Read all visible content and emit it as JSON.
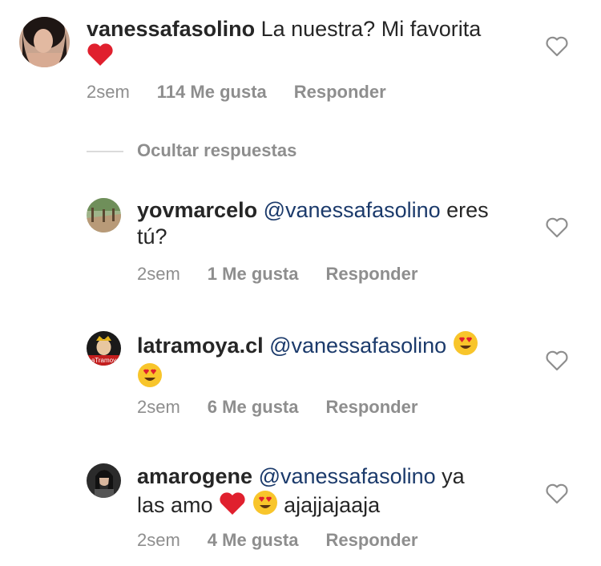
{
  "comments": [
    {
      "username": "vanessafasolino",
      "before": "",
      "mention": "",
      "after": " La nuestra? Mi favorita",
      "line2_emojis": [
        "heart-emoji"
      ],
      "line2_text": "",
      "time": "2sem",
      "likes": "114 Me gusta",
      "reply": "Responder",
      "avatar": "portrait-avatar"
    },
    {
      "username": "yovmarcelo",
      "mention": "@vanessafasolino",
      "after": " eres",
      "line2_text": "tú?",
      "time": "2sem",
      "likes": "1 Me gusta",
      "reply": "Responder",
      "avatar": "landscape-avatar"
    },
    {
      "username": "latramoya.cl",
      "mention": "@vanessafasolino",
      "time": "2sem",
      "likes": "6 Me gusta",
      "reply": "Responder",
      "avatar": "logo-avatar"
    },
    {
      "username": "amarogene",
      "mention": "@vanessafasolino",
      "after": " ya",
      "line2_prefix": "las amo",
      "line2_suffix": "ajajjajaaja",
      "time": "2sem",
      "likes": "4 Me gusta",
      "reply": "Responder",
      "avatar": "portrait-avatar"
    }
  ],
  "hide_replies": "Ocultar respuestas",
  "colors": {
    "text": "#262626",
    "muted": "#8e8e8e",
    "mention": "#1b3a6b",
    "heart": "#e0202e"
  }
}
